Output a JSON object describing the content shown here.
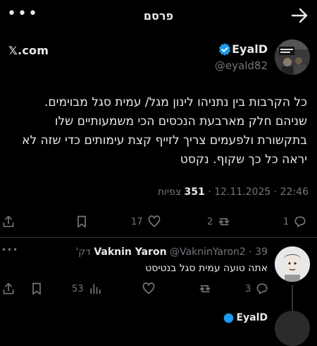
{
  "header": {
    "title": "פרסם",
    "more_label": "•••"
  },
  "author": {
    "name": "EyalD",
    "handle": "@eyald82",
    "source_link": "𝕏.com"
  },
  "post": {
    "text": "כל הקרבות בין נתניהו לינון מגל/ עמית סגל מבוימים. שניהם חלק מארבעת הנכסים הכי משמעותיים שלו בתקשורת ולפעמים צריך לזייף קצת עימותים כדי שזה לא יראה כל כך שקוף. נקסט",
    "time": "22:46",
    "date": "12.11.2025",
    "views": "351",
    "views_label": "צפיות",
    "separator": "·"
  },
  "post_actions": {
    "replies": "1",
    "reposts": "2",
    "likes": "17"
  },
  "reply": {
    "name": "Vaknin Yaron",
    "handle": "@VakninYaron2",
    "age": "39 דק'",
    "separator": "·",
    "text": "אתה טועה עמית סגל בנטיסט",
    "replies": "3",
    "views": "53",
    "more_label": "•••"
  },
  "next_reply": {
    "name": "EyalD"
  },
  "colors": {
    "background": "#000000",
    "text": "#e7e9ea",
    "muted": "#71767b",
    "verified": "#1d9bf0",
    "divider": "#2f3336"
  },
  "icons": [
    "more-icon",
    "back-arrow-icon",
    "verified-icon",
    "reply-icon",
    "repost-icon",
    "like-icon",
    "bookmark-icon",
    "share-icon",
    "views-icon"
  ]
}
